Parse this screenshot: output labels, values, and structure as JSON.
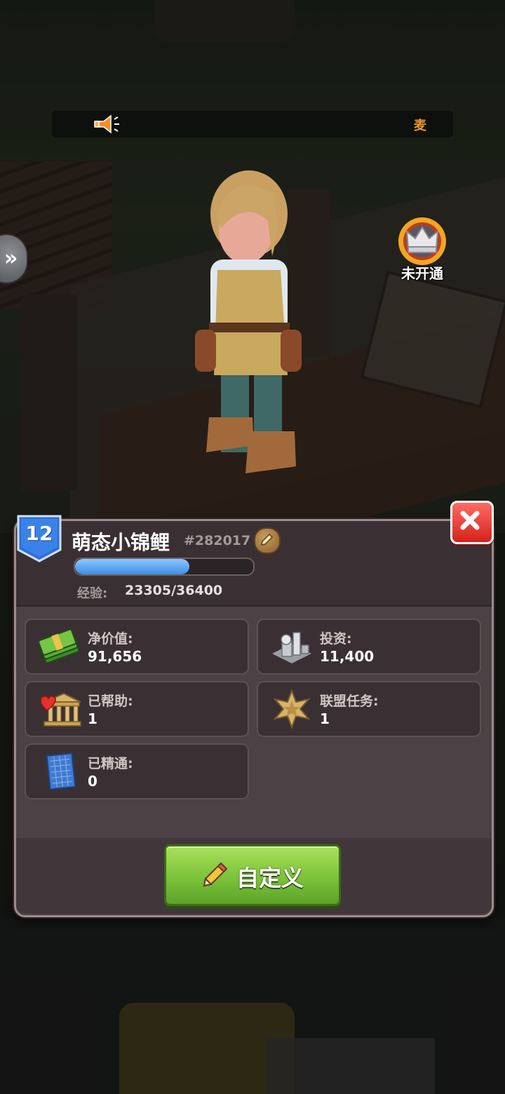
{
  "notice": {
    "ticker_text": "麦"
  },
  "vip": {
    "status_label": "未开通"
  },
  "profile": {
    "level": "12",
    "name": "萌态小锦鲤",
    "id": "#282017",
    "exp_label": "经验:",
    "exp_value": "23305/36400",
    "exp_progress": 0.64
  },
  "stats": [
    {
      "label": "净价值:",
      "value": "91,656",
      "icon": "cash-stack-icon"
    },
    {
      "label": "投资:",
      "value": "11,400",
      "icon": "building-icon"
    },
    {
      "label": "已帮助:",
      "value": "1",
      "icon": "charity-building-icon"
    },
    {
      "label": "联盟任务:",
      "value": "1",
      "icon": "sheriff-star-icon"
    },
    {
      "label": "已精通:",
      "value": "0",
      "icon": "blueprint-icon"
    }
  ],
  "actions": {
    "customize_label": "自定义"
  },
  "colors": {
    "accent_green": "#7cc23a",
    "close_red": "#d2231c",
    "exp_blue": "#3d8de6",
    "panel_bg": "#4c4144",
    "ticker_orange": "#f09a2a"
  }
}
